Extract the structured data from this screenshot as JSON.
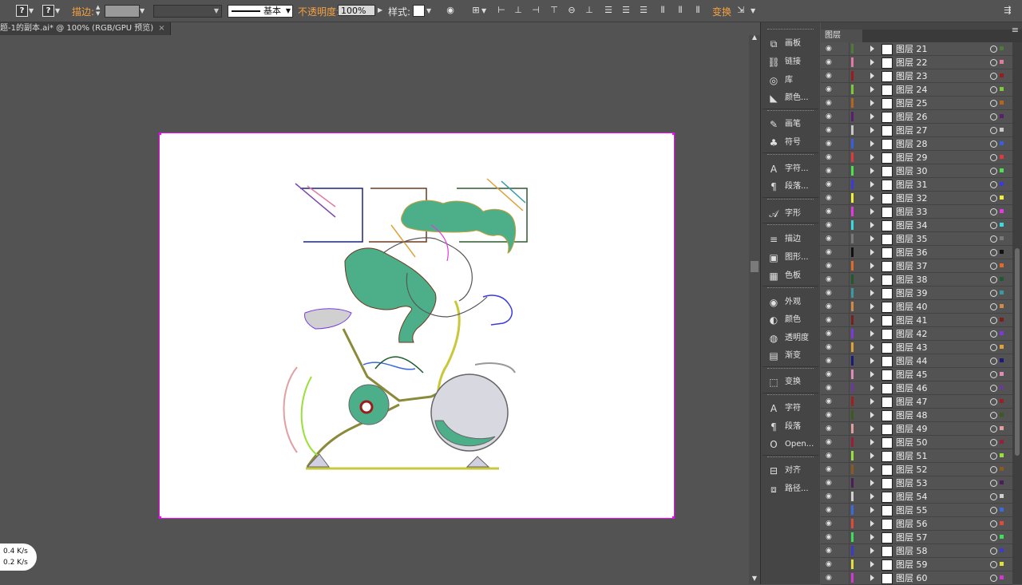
{
  "control_bar": {
    "fill_q": "?",
    "stroke_q": "?",
    "stroke_label": "描边:",
    "brush_label": "基本",
    "opacity_label": "不透明度:",
    "opacity_value": "100%",
    "style_label": "样式:",
    "transform_label": "变换"
  },
  "document": {
    "tab_title": "题-1的副本.ai* @ 100% (RGB/GPU 预览)"
  },
  "net_monitor": {
    "up": "0.4 K/s",
    "down": "0.2 K/s"
  },
  "dock": {
    "items": [
      {
        "label": "画板",
        "icon": "artboards-icon"
      },
      {
        "label": "链接",
        "icon": "links-icon"
      },
      {
        "label": "库",
        "icon": "libraries-icon"
      },
      {
        "label": "颜色...",
        "icon": "color-guide-icon"
      },
      {
        "label": "画笔",
        "icon": "brushes-icon"
      },
      {
        "label": "符号",
        "icon": "symbols-icon"
      },
      {
        "label": "字符...",
        "icon": "character-styles-icon"
      },
      {
        "label": "段落...",
        "icon": "paragraph-styles-icon"
      },
      {
        "label": "字形",
        "icon": "glyphs-icon"
      },
      {
        "label": "描边",
        "icon": "stroke-icon"
      },
      {
        "label": "图形...",
        "icon": "graphic-styles-icon"
      },
      {
        "label": "色板",
        "icon": "swatches-icon"
      },
      {
        "label": "外观",
        "icon": "appearance-icon"
      },
      {
        "label": "颜色",
        "icon": "color-icon"
      },
      {
        "label": "透明度",
        "icon": "transparency-icon"
      },
      {
        "label": "渐变",
        "icon": "gradient-icon"
      },
      {
        "label": "变换",
        "icon": "transform-icon"
      },
      {
        "label": "字符",
        "icon": "character-icon"
      },
      {
        "label": "段落",
        "icon": "paragraph-icon"
      },
      {
        "label": "Open...",
        "icon": "opentype-icon"
      },
      {
        "label": "对齐",
        "icon": "align-icon"
      },
      {
        "label": "路径...",
        "icon": "pathfinder-icon"
      }
    ]
  },
  "layers_panel": {
    "tab": "图层",
    "layers": [
      {
        "name": "图层 21",
        "color": "#4f7a3a"
      },
      {
        "name": "图层 22",
        "color": "#e07aa0"
      },
      {
        "name": "图层 23",
        "color": "#9b1c1c"
      },
      {
        "name": "图层 24",
        "color": "#7ec83a"
      },
      {
        "name": "图层 25",
        "color": "#b5651d"
      },
      {
        "name": "图层 26",
        "color": "#5a1e6e"
      },
      {
        "name": "图层 27",
        "color": "#c8c8c8"
      },
      {
        "name": "图层 28",
        "color": "#3a5ee0"
      },
      {
        "name": "图层 29",
        "color": "#e03a3a"
      },
      {
        "name": "图层 30",
        "color": "#4ee04e"
      },
      {
        "name": "图层 31",
        "color": "#3a3ae0"
      },
      {
        "name": "图层 32",
        "color": "#f0f03a"
      },
      {
        "name": "图层 33",
        "color": "#e03ae0"
      },
      {
        "name": "图层 34",
        "color": "#3ad8e0"
      },
      {
        "name": "图层 35",
        "color": "#7a7a7a"
      },
      {
        "name": "图层 36",
        "color": "#111111"
      },
      {
        "name": "图层 37",
        "color": "#e06a2a"
      },
      {
        "name": "图层 38",
        "color": "#1e5a2e"
      },
      {
        "name": "图层 39",
        "color": "#3a9aa0"
      },
      {
        "name": "图层 40",
        "color": "#d08a4a"
      },
      {
        "name": "图层 41",
        "color": "#7a1e1e"
      },
      {
        "name": "图层 42",
        "color": "#7a3ae0"
      },
      {
        "name": "图层 43",
        "color": "#e0a03a"
      },
      {
        "name": "图层 44",
        "color": "#1a1a7a"
      },
      {
        "name": "图层 45",
        "color": "#e08ab8"
      },
      {
        "name": "图层 46",
        "color": "#6a3a9a"
      },
      {
        "name": "图层 47",
        "color": "#a01e1e"
      },
      {
        "name": "图层 48",
        "color": "#3a5a1e"
      },
      {
        "name": "图层 49",
        "color": "#e0a0a0"
      },
      {
        "name": "图层 50",
        "color": "#9a1e3a"
      },
      {
        "name": "图层 51",
        "color": "#9ae03a"
      },
      {
        "name": "图层 52",
        "color": "#8a5a1e"
      },
      {
        "name": "图层 53",
        "color": "#4a1e5a"
      },
      {
        "name": "图层 54",
        "color": "#d0d0d0"
      },
      {
        "name": "图层 55",
        "color": "#3a6ae0"
      },
      {
        "name": "图层 56",
        "color": "#e04a3a"
      },
      {
        "name": "图层 57",
        "color": "#3ae05a"
      },
      {
        "name": "图层 58",
        "color": "#3a3ad0"
      },
      {
        "name": "图层 59",
        "color": "#e0e03a"
      },
      {
        "name": "图层 60",
        "color": "#d03ad0"
      }
    ]
  }
}
